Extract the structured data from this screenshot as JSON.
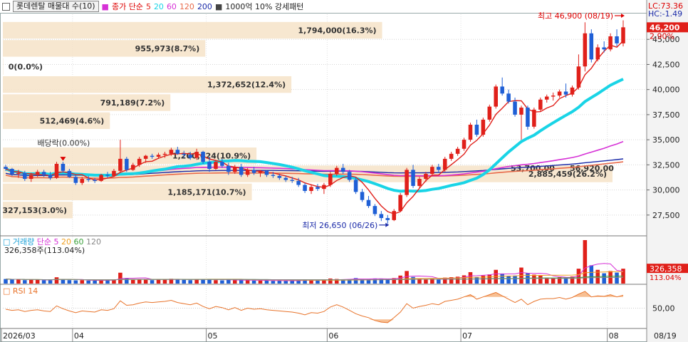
{
  "header": {
    "title": "롯데렌탈 매물대 수(10)",
    "ma_label": "종가 단순",
    "ma_periods": [
      {
        "v": "5",
        "color": "#e0201a"
      },
      {
        "v": "20",
        "color": "#19d4e6"
      },
      {
        "v": "60",
        "color": "#d631d6"
      },
      {
        "v": "120",
        "color": "#e86a4a"
      },
      {
        "v": "200",
        "color": "#1a2aa8"
      }
    ],
    "pattern_label": "1000억 10% 강세패턴"
  },
  "axis": {
    "price_ticks": [
      "45,000",
      "42,500",
      "40,000",
      "37,500",
      "35,000",
      "32,500",
      "30,000",
      "27,500"
    ],
    "price_values": [
      45000,
      42500,
      40000,
      37500,
      35000,
      32500,
      30000,
      27500
    ],
    "lc": "LC:73.36",
    "hc": "HC:-1.49",
    "last_price": "46,200",
    "last_pct": "2.90%",
    "date_labels": [
      {
        "t": "2026/03",
        "i": 0
      },
      {
        "t": "04",
        "i": 11
      },
      {
        "t": "05",
        "i": 32
      },
      {
        "t": "06",
        "i": 51
      },
      {
        "t": "07",
        "i": 72
      },
      {
        "t": "08",
        "i": 95
      }
    ],
    "date_end": "08/19"
  },
  "annotations": {
    "high": "최고 46,900 (08/19)",
    "low": "최저 26,650 (06/26)",
    "dividend": "배당락(0.00%)"
  },
  "volume_profile": [
    {
      "label": "1,794,000(16.3%)",
      "pct": 16.3,
      "low": 45000,
      "high": 46800
    },
    {
      "label": "955,973(8.7%)",
      "pct": 8.7,
      "low": 43200,
      "high": 45000
    },
    {
      "label": "0(0.0%)",
      "pct": 0.0,
      "low": 41400,
      "high": 43200
    },
    {
      "label": "1,372,652(12.4%)",
      "pct": 12.4,
      "low": 39600,
      "high": 41400
    },
    {
      "label": "791,189(7.2%)",
      "pct": 7.2,
      "low": 37800,
      "high": 39600
    },
    {
      "label": "512,469(4.6%)",
      "pct": 4.6,
      "low": 36000,
      "high": 37800
    },
    {
      "label": "1,200,624(10.9%)",
      "pct": 10.9,
      "low": 32500,
      "high": 34300
    },
    {
      "label": "2,885,459(26.2%)",
      "pct": 26.2,
      "low": 30700,
      "high": 32500
    },
    {
      "label": "1,185,171(10.7%)",
      "pct": 10.7,
      "low": 28900,
      "high": 30700
    },
    {
      "label": "327,153(3.0%)",
      "pct": 3.0,
      "low": 27100,
      "high": 28900
    }
  ],
  "profile_overlay_labels": [
    {
      "t": "53,700,00",
      "x": 717,
      "y": 240
    },
    {
      "t": "56,920,00",
      "x": 800,
      "y": 240
    }
  ],
  "volume_panel": {
    "title": "거래량",
    "ma_label": "단순",
    "ma_periods": [
      {
        "v": "5",
        "color": "#d631d6"
      },
      {
        "v": "20",
        "color": "#f0a020"
      },
      {
        "v": "60",
        "color": "#3aa03a"
      },
      {
        "v": "120",
        "color": "#888888"
      }
    ],
    "current": "326,358주(113.04%)",
    "last_value": "326,358",
    "last_pct": "113.04%"
  },
  "rsi_panel": {
    "title": "RSI 14",
    "tick": "50,00"
  },
  "chart_data": {
    "type": "candlestick",
    "start_date": "2026/03",
    "end_date": "08/19",
    "ylim": [
      25500,
      47500
    ],
    "candles": [
      [
        32300,
        32500,
        31900,
        32100
      ],
      [
        32100,
        32200,
        31400,
        31600
      ],
      [
        31600,
        32000,
        31200,
        31700
      ],
      [
        31700,
        31900,
        30900,
        31100
      ],
      [
        31100,
        31700,
        30800,
        31500
      ],
      [
        31500,
        32000,
        31300,
        31800
      ],
      [
        31800,
        32000,
        31300,
        31500
      ],
      [
        31500,
        31800,
        31000,
        31200
      ],
      [
        31200,
        32800,
        31100,
        32600
      ],
      [
        32600,
        32800,
        31700,
        31900
      ],
      [
        31900,
        32100,
        31200,
        31300
      ],
      [
        31300,
        31500,
        30500,
        30700
      ],
      [
        30700,
        31300,
        30500,
        31100
      ],
      [
        31100,
        31400,
        30800,
        31000
      ],
      [
        31000,
        31200,
        30700,
        30900
      ],
      [
        30900,
        31600,
        30800,
        31500
      ],
      [
        31500,
        31800,
        31200,
        31400
      ],
      [
        31400,
        32100,
        31300,
        31900
      ],
      [
        31900,
        35000,
        31700,
        33100
      ],
      [
        33100,
        33300,
        31800,
        32000
      ],
      [
        32000,
        32700,
        31900,
        32500
      ],
      [
        32500,
        33300,
        32300,
        33100
      ],
      [
        33100,
        33500,
        32700,
        33400
      ],
      [
        33400,
        33600,
        33100,
        33300
      ],
      [
        33300,
        33700,
        33100,
        33500
      ],
      [
        33500,
        33800,
        33200,
        33600
      ],
      [
        33600,
        34200,
        33400,
        34000
      ],
      [
        34000,
        34300,
        33500,
        33600
      ],
      [
        33600,
        33900,
        33200,
        33500
      ],
      [
        33500,
        33800,
        33000,
        33200
      ],
      [
        33200,
        34100,
        33000,
        33800
      ],
      [
        33800,
        33900,
        32600,
        32800
      ],
      [
        32800,
        33300,
        31800,
        32100
      ],
      [
        32100,
        33000,
        32000,
        32800
      ],
      [
        32800,
        33100,
        32200,
        32400
      ],
      [
        32400,
        32700,
        31500,
        31800
      ],
      [
        31800,
        32500,
        31600,
        32300
      ],
      [
        32300,
        32600,
        31300,
        31500
      ],
      [
        31500,
        32200,
        31300,
        32000
      ],
      [
        32000,
        32300,
        31500,
        31700
      ],
      [
        31700,
        32000,
        31300,
        31900
      ],
      [
        31900,
        32000,
        31300,
        31500
      ],
      [
        31500,
        31800,
        31200,
        31400
      ],
      [
        31400,
        31600,
        31000,
        31200
      ],
      [
        31200,
        31400,
        30800,
        31000
      ],
      [
        31000,
        31300,
        30700,
        30900
      ],
      [
        30900,
        31200,
        30300,
        30500
      ],
      [
        30500,
        30700,
        29700,
        29900
      ],
      [
        29900,
        30500,
        29600,
        30300
      ],
      [
        30300,
        30600,
        29900,
        30100
      ],
      [
        30100,
        30700,
        29600,
        30500
      ],
      [
        30500,
        31800,
        30300,
        31600
      ],
      [
        31600,
        32400,
        31400,
        32200
      ],
      [
        32200,
        32600,
        31600,
        31800
      ],
      [
        31800,
        32000,
        30800,
        31000
      ],
      [
        31000,
        31300,
        29600,
        29800
      ],
      [
        29800,
        30100,
        28800,
        29000
      ],
      [
        29000,
        29400,
        28200,
        28400
      ],
      [
        28400,
        28600,
        27400,
        27600
      ],
      [
        27600,
        27900,
        26900,
        27200
      ],
      [
        27200,
        27500,
        26650,
        27000
      ],
      [
        27000,
        28100,
        26900,
        27900
      ],
      [
        27900,
        29700,
        27800,
        29500
      ],
      [
        29500,
        32200,
        29300,
        32000
      ],
      [
        32000,
        32500,
        30200,
        30400
      ],
      [
        30400,
        31300,
        30200,
        31100
      ],
      [
        31100,
        31800,
        30800,
        31600
      ],
      [
        31600,
        32500,
        31400,
        32300
      ],
      [
        32300,
        32600,
        31700,
        32000
      ],
      [
        32000,
        33300,
        31800,
        33100
      ],
      [
        33100,
        33800,
        32900,
        33600
      ],
      [
        33600,
        34300,
        33400,
        34100
      ],
      [
        34100,
        35200,
        33900,
        35000
      ],
      [
        35000,
        36700,
        34800,
        36500
      ],
      [
        36500,
        37000,
        35300,
        35500
      ],
      [
        35500,
        37200,
        35300,
        37000
      ],
      [
        37000,
        38500,
        36800,
        38300
      ],
      [
        38300,
        40500,
        38100,
        40300
      ],
      [
        40300,
        41200,
        39400,
        39600
      ],
      [
        39600,
        40000,
        38600,
        38800
      ],
      [
        38800,
        39200,
        37300,
        37500
      ],
      [
        37500,
        38400,
        35000,
        38200
      ],
      [
        38200,
        38400,
        36000,
        36300
      ],
      [
        36300,
        38200,
        36100,
        38000
      ],
      [
        38000,
        39200,
        37800,
        39000
      ],
      [
        39000,
        39500,
        38700,
        39300
      ],
      [
        39300,
        39700,
        38900,
        39400
      ],
      [
        39400,
        40000,
        39200,
        39800
      ],
      [
        39800,
        40600,
        39200,
        39500
      ],
      [
        39500,
        40400,
        39300,
        40200
      ],
      [
        40200,
        43500,
        40000,
        42300
      ],
      [
        42300,
        46700,
        41800,
        45600
      ],
      [
        45600,
        46000,
        42700,
        43000
      ],
      [
        43000,
        44500,
        42800,
        44200
      ],
      [
        44200,
        44800,
        43700,
        44000
      ],
      [
        44000,
        45600,
        43800,
        45300
      ],
      [
        45300,
        46000,
        44300,
        44600
      ],
      [
        44600,
        46900,
        44300,
        46200
      ]
    ],
    "volumes": [
      40,
      35,
      38,
      30,
      32,
      36,
      30,
      28,
      55,
      34,
      30,
      28,
      30,
      26,
      25,
      32,
      30,
      34,
      95,
      44,
      32,
      40,
      38,
      30,
      34,
      36,
      42,
      40,
      32,
      30,
      38,
      40,
      36,
      30,
      28,
      34,
      30,
      32,
      28,
      26,
      26,
      28,
      24,
      26,
      24,
      24,
      30,
      36,
      28,
      26,
      30,
      44,
      40,
      34,
      38,
      48,
      40,
      38,
      44,
      40,
      42,
      48,
      70,
      110,
      58,
      44,
      40,
      46,
      38,
      52,
      56,
      60,
      72,
      100,
      58,
      70,
      80,
      120,
      88,
      66,
      70,
      140,
      90,
      78,
      70,
      52,
      48,
      56,
      50,
      62,
      130,
      380,
      160,
      120,
      90,
      110,
      96,
      130
    ],
    "rsi": [
      48,
      46,
      47,
      44,
      46,
      47,
      45,
      44,
      54,
      49,
      45,
      42,
      45,
      44,
      43,
      47,
      46,
      49,
      63,
      55,
      56,
      59,
      61,
      60,
      61,
      62,
      64,
      60,
      58,
      56,
      59,
      53,
      49,
      53,
      51,
      47,
      51,
      46,
      50,
      48,
      49,
      47,
      46,
      45,
      44,
      43,
      41,
      38,
      42,
      41,
      44,
      52,
      56,
      52,
      46,
      40,
      36,
      33,
      28,
      25,
      24,
      33,
      43,
      58,
      50,
      53,
      55,
      58,
      56,
      62,
      64,
      66,
      70,
      74,
      66,
      70,
      74,
      78,
      72,
      66,
      60,
      66,
      56,
      62,
      66,
      67,
      67,
      69,
      66,
      69,
      75,
      80,
      70,
      72,
      71,
      74,
      70,
      73
    ]
  }
}
